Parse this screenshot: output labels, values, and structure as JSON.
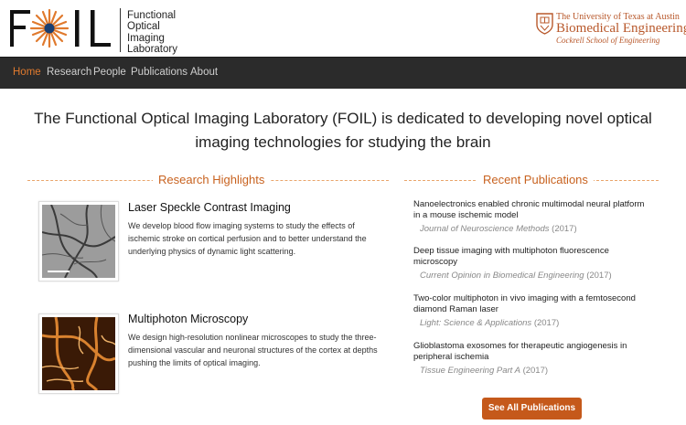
{
  "header": {
    "logo_text": "FOIL",
    "lab_name_lines": [
      "Functional",
      "Optical",
      "Imaging",
      "Laboratory"
    ],
    "ut": {
      "line1": "The University of Texas at Austin",
      "line2": "Biomedical Engineering",
      "line3": "Cockrell School of Engineering"
    }
  },
  "nav": {
    "items": [
      {
        "label": "Home",
        "active": true
      },
      {
        "label": "Research",
        "active": false
      },
      {
        "label": "People",
        "active": false
      },
      {
        "label": "Publications",
        "active": false
      },
      {
        "label": "About",
        "active": false
      }
    ]
  },
  "hero": {
    "line1": "The Functional Optical Imaging Laboratory (FOIL) is dedicated to developing novel optical",
    "line2": "imaging technologies for studying the brain"
  },
  "research": {
    "title": "Research Highlights",
    "items": [
      {
        "title": "Laser Speckle Contrast Imaging",
        "text": "We develop blood flow imaging systems to study the effects of ischemic stroke on cortical perfusion and to better understand the underlying physics of dynamic light scattering."
      },
      {
        "title": "Multiphoton Microscopy",
        "text": "We design high-resolution nonlinear microscopes to study the three-dimensional vascular and neuronal structures of the cortex at depths pushing the limits of optical imaging."
      }
    ]
  },
  "publications": {
    "title": "Recent Publications",
    "items": [
      {
        "title": "Nanoelectronics enabled chronic multimodal neural platform in a mouse ischemic model",
        "journal": "Journal of Neuroscience Methods",
        "year": "(2017)"
      },
      {
        "title": "Deep tissue imaging with multiphoton fluorescence microscopy",
        "journal": "Current Opinion in Biomedical Engineering",
        "year": "(2017)"
      },
      {
        "title": "Two-color multiphoton in vivo imaging with a femtosecond diamond Raman laser",
        "journal": "Light: Science & Applications",
        "year": "(2017)"
      },
      {
        "title": "Glioblastoma exosomes for therapeutic angiogenesis in peripheral ischemia",
        "journal": "Tissue Engineering Part A",
        "year": "(2017)"
      }
    ],
    "button_label": "See All Publications"
  },
  "colors": {
    "accent": "#c5591b",
    "nav_active": "#e07a2e",
    "navbar_bg": "#2b2b2b",
    "ut_orange": "#b8582b"
  }
}
